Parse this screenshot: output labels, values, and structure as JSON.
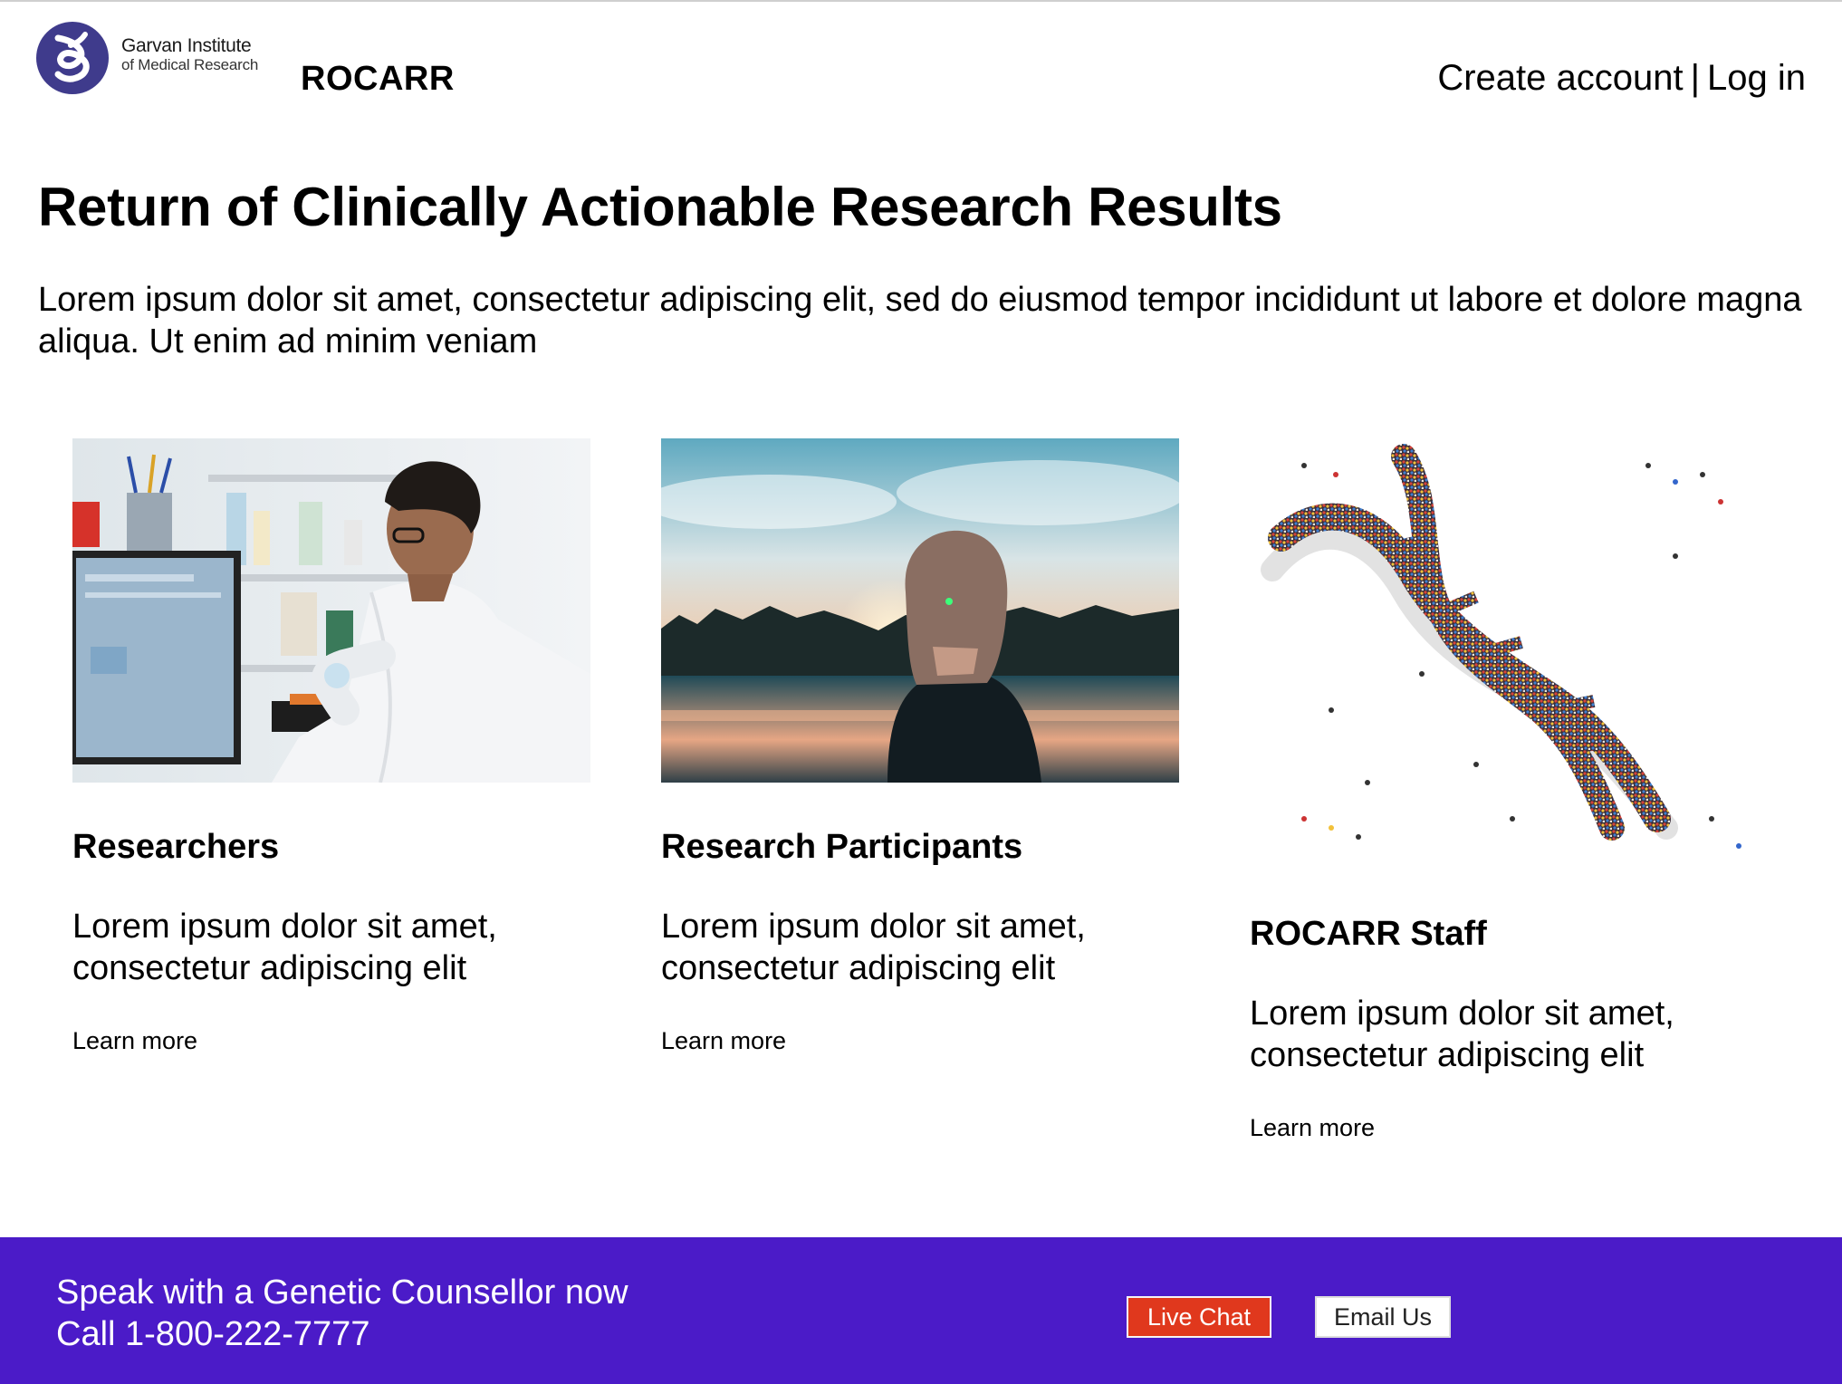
{
  "header": {
    "logo_line1": "Garvan Institute",
    "logo_line2": "of Medical Research",
    "brand": "ROCARR",
    "create_account": "Create account",
    "separator": "|",
    "log_in": "Log in"
  },
  "hero": {
    "title": "Return of Clinically Actionable Research Results",
    "text": "Lorem ipsum dolor sit amet, consectetur adipiscing elit, sed do eiusmod tempor incididunt ut labore et dolore magna aliqua. Ut enim ad minim veniam"
  },
  "cards": [
    {
      "title": "Researchers",
      "description": "Lorem ipsum dolor sit amet, consectetur adipiscing elit",
      "link": "Learn more"
    },
    {
      "title": "Research Participants",
      "description": "Lorem ipsum dolor sit amet, consectetur adipiscing elit",
      "link": "Learn more"
    },
    {
      "title": "ROCARR Staff",
      "description": "Lorem ipsum dolor sit amet, consectetur adipiscing elit",
      "link": "Learn more"
    }
  ],
  "footer": {
    "line1": "Speak with a Genetic Counsellor now",
    "line2": "Call 1-800-222-7777",
    "live_chat": "Live Chat",
    "email_us": "Email Us"
  },
  "colors": {
    "footer_bg": "#4b1bc8",
    "live_chat_bg": "#e0381d",
    "logo_blue": "#3f3b8c"
  }
}
